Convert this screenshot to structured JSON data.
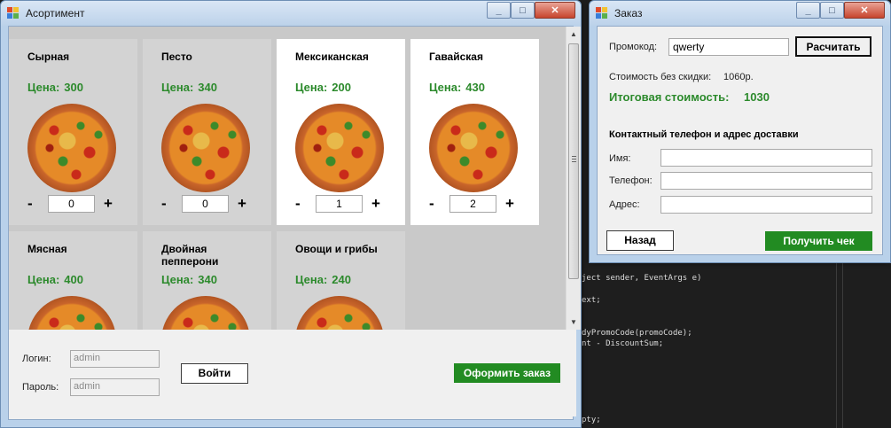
{
  "assortment_window": {
    "title": "Асортимент",
    "items": [
      {
        "name": "Сырная",
        "price_label": "Цена:",
        "price": "300",
        "qty": "0",
        "minus": "-",
        "plus": "+"
      },
      {
        "name": "Песто",
        "price_label": "Цена:",
        "price": "340",
        "qty": "0",
        "minus": "-",
        "plus": "+"
      },
      {
        "name": "Мексиканская",
        "price_label": "Цена:",
        "price": "200",
        "qty": "1",
        "minus": "-",
        "plus": "+"
      },
      {
        "name": "Гавайская",
        "price_label": "Цена:",
        "price": "430",
        "qty": "2",
        "minus": "-",
        "plus": "+"
      },
      {
        "name": "Мясная",
        "price_label": "Цена:",
        "price": "400"
      },
      {
        "name": "Двойная пепперони",
        "price_label": "Цена:",
        "price": "340"
      },
      {
        "name": "Овощи и грибы",
        "price_label": "Цена:",
        "price": "240"
      }
    ],
    "login": {
      "label": "Логин:",
      "value": "admin"
    },
    "password": {
      "label": "Пароль:",
      "value": "admin"
    },
    "login_button": "Войти",
    "checkout_button": "Оформить заказ"
  },
  "order_window": {
    "title": "Заказ",
    "promo_label": "Промокод:",
    "promo_value": "qwerty",
    "calc_button": "Расчитать",
    "subtotal_label": "Стоимость без скидки:",
    "subtotal_value": "1060р.",
    "total_label": "Итоговая стоимость:",
    "total_value": "1030",
    "contact_title": "Контактный телефон и адрес доставки",
    "name_label": "Имя:",
    "phone_label": "Телефон:",
    "address_label": "Адрес:",
    "name_value": "",
    "phone_value": "",
    "address_value": "",
    "back_button": "Назад",
    "receipt_button": "Получить чек"
  },
  "code_editor": {
    "lines": [
      "ject sender, EventArgs e)",
      "ext;",
      "dyPromoCode(promoCode);",
      "nt - DiscountSum;",
      "pty;"
    ]
  },
  "window_controls": {
    "minimize": "_",
    "maximize": "□",
    "close": "✕"
  }
}
